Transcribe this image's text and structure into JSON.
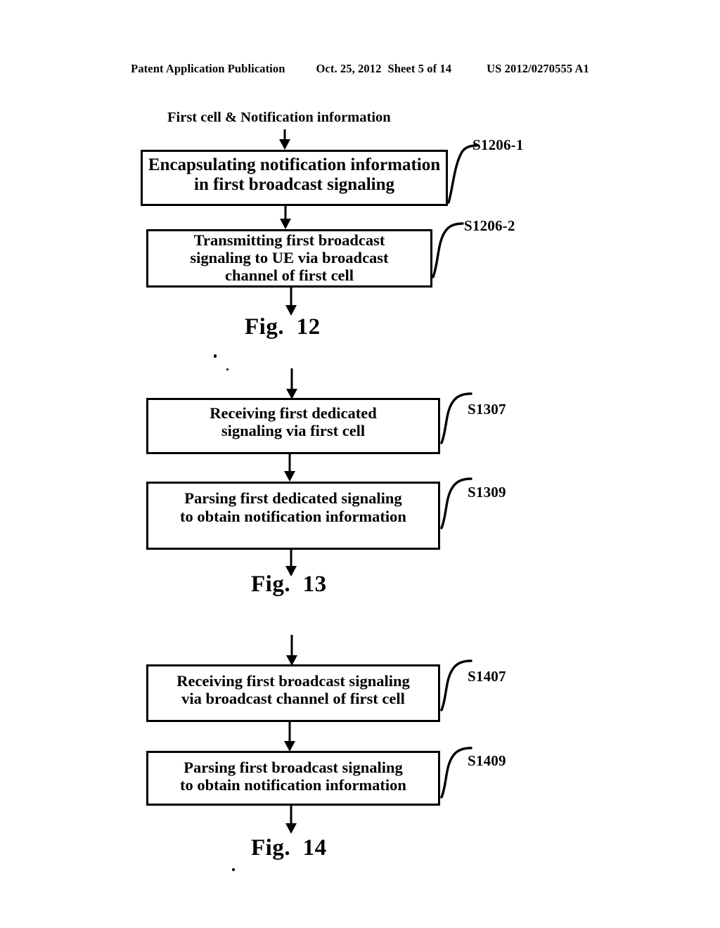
{
  "header": {
    "publication": "Patent Application Publication",
    "date": "Oct. 25, 2012",
    "sheet": "Sheet 5 of 14",
    "patent_number": "US 2012/0270555 A1"
  },
  "figures": [
    {
      "caption": "Fig.  12",
      "input_label": "First cell & Notification information",
      "steps": [
        {
          "id": "S1206-1",
          "text": "Encapsulating notification information\nin first broadcast signaling"
        },
        {
          "id": "S1206-2",
          "text": "Transmitting first broadcast\nsignaling to UE via broadcast\nchannel of first cell"
        }
      ]
    },
    {
      "caption": "Fig.  13",
      "input_label": "",
      "steps": [
        {
          "id": "S1307",
          "text": "Receiving first dedicated\nsignaling via first cell"
        },
        {
          "id": "S1309",
          "text": "Parsing first dedicated signaling\nto obtain notification information"
        }
      ]
    },
    {
      "caption": "Fig.  14",
      "input_label": "",
      "steps": [
        {
          "id": "S1407",
          "text": "Receiving first broadcast signaling\nvia broadcast channel of first cell"
        },
        {
          "id": "S1409",
          "text": "Parsing first broadcast signaling\nto obtain notification information"
        }
      ]
    }
  ],
  "colors": {
    "ink": "#000000",
    "paper": "#ffffff"
  }
}
